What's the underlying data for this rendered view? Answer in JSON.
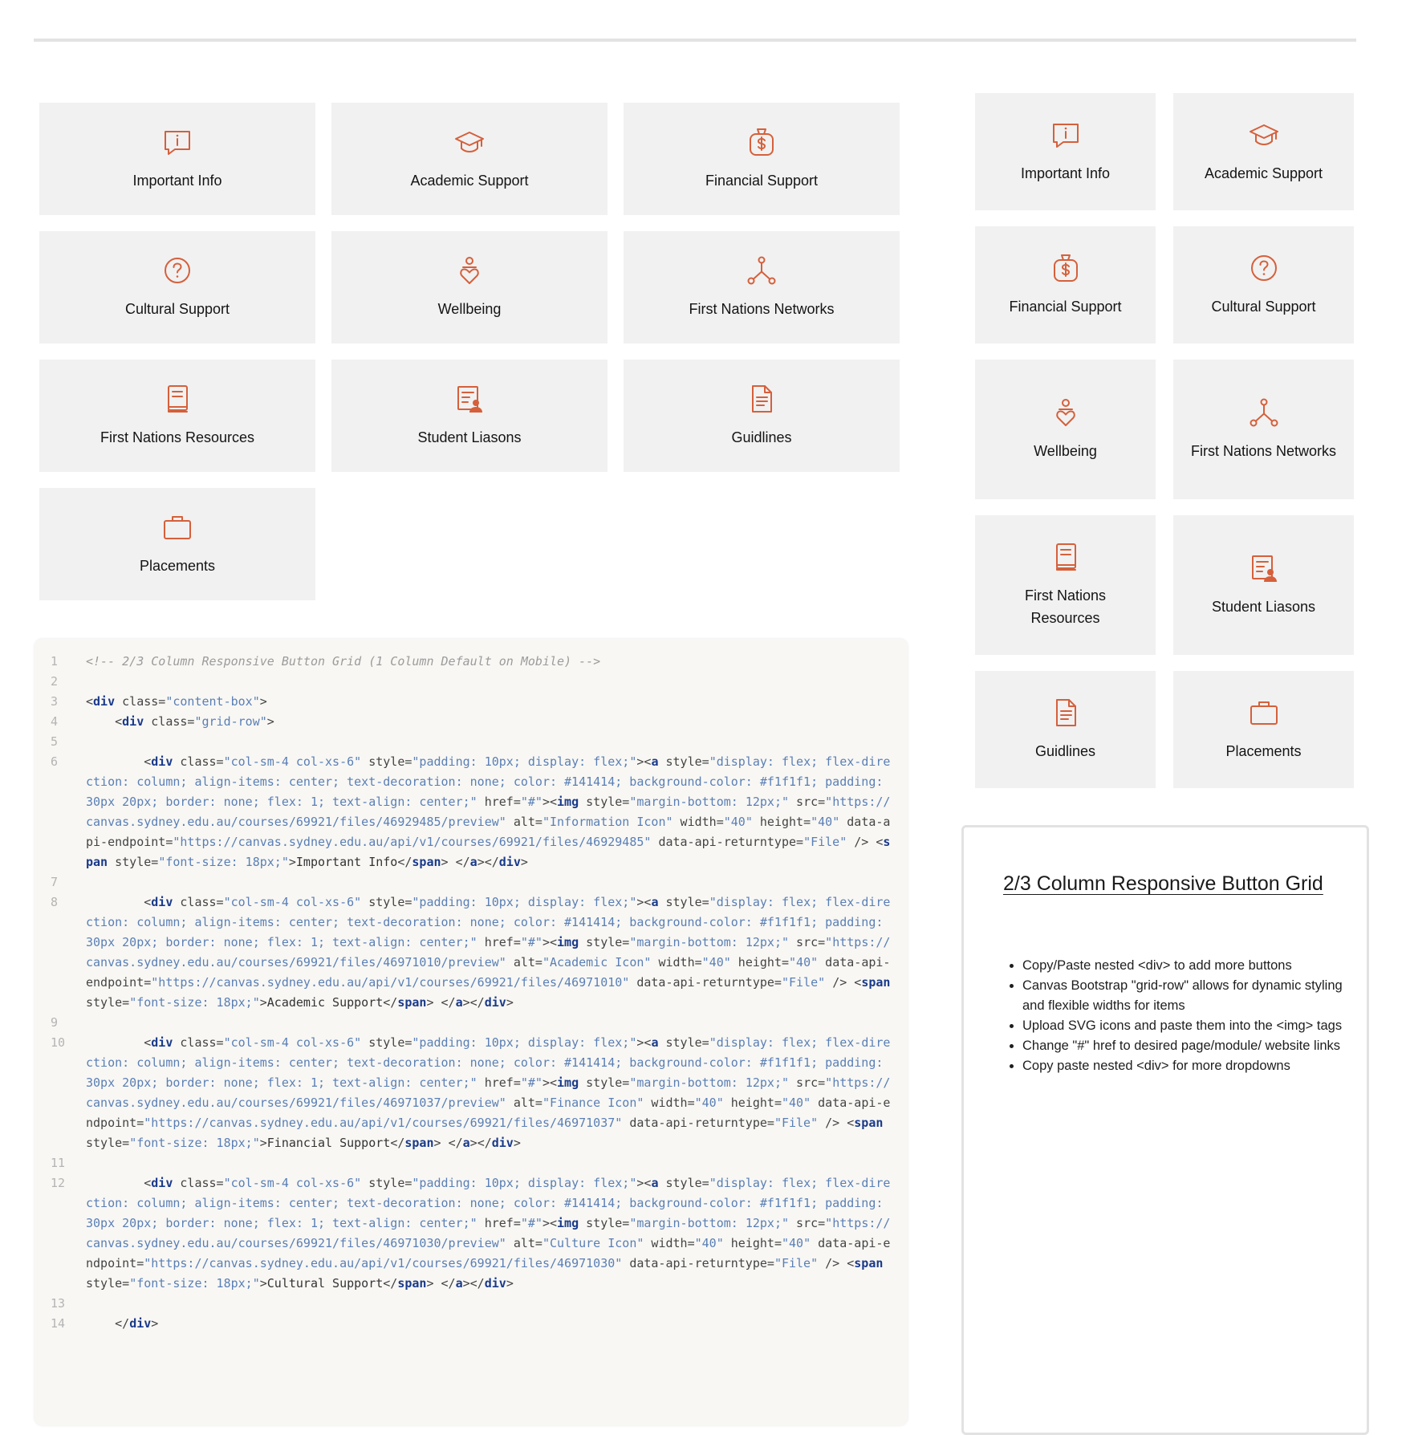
{
  "colors": {
    "accent": "#d5603b",
    "card_bg": "#f1f1f1",
    "text": "#141414"
  },
  "grid_three_col": [
    {
      "label": "Important Info",
      "icon": "info-icon"
    },
    {
      "label": "Academic Support",
      "icon": "graduation-cap-icon"
    },
    {
      "label": "Financial Support",
      "icon": "money-bag-icon"
    },
    {
      "label": "Cultural Support",
      "icon": "question-circle-icon"
    },
    {
      "label": "Wellbeing",
      "icon": "person-heart-icon"
    },
    {
      "label": "First Nations Networks",
      "icon": "network-icon"
    },
    {
      "label": "First Nations Resources",
      "icon": "book-icon"
    },
    {
      "label": "Student Liasons",
      "icon": "student-liaison-icon"
    },
    {
      "label": "Guidlines",
      "icon": "document-icon"
    },
    {
      "label": "Placements",
      "icon": "briefcase-icon"
    }
  ],
  "grid_two_col": [
    {
      "label": "Important Info",
      "icon": "info-icon"
    },
    {
      "label": "Academic Support",
      "icon": "graduation-cap-icon"
    },
    {
      "label": "Financial Support",
      "icon": "money-bag-icon"
    },
    {
      "label": "Cultural Support",
      "icon": "question-circle-icon"
    },
    {
      "label": "Wellbeing",
      "icon": "person-heart-icon"
    },
    {
      "label": "First Nations Networks",
      "icon": "network-icon"
    },
    {
      "label": "First Nations Resources",
      "icon": "book-icon"
    },
    {
      "label": "Student Liasons",
      "icon": "student-liaison-icon"
    },
    {
      "label": "Guidlines",
      "icon": "document-icon"
    },
    {
      "label": "Placements",
      "icon": "briefcase-icon"
    }
  ],
  "code_lines": [
    {
      "n": "1",
      "text": "<!-- 2/3 Column Responsive Button Grid (1 Column Default on Mobile) -->"
    },
    {
      "n": "2",
      "text": ""
    },
    {
      "n": "3",
      "text": "<div class=\"content-box\">"
    },
    {
      "n": "4",
      "text": "    <div class=\"grid-row\">"
    },
    {
      "n": "5",
      "text": ""
    },
    {
      "n": "6",
      "text": "        <div class=\"col-sm-4 col-xs-6\" style=\"padding: 10px; display: flex;\"><a style=\"display: flex; flex-direction: column; align-items: center; text-decoration: none; color: #141414; background-color: #f1f1f1; padding: 30px 20px; border: none; flex: 1; text-align: center;\" href=\"#\"><img style=\"margin-bottom: 12px;\" src=\"https://canvas.sydney.edu.au/courses/69921/files/46929485/preview\" alt=\"Information Icon\" width=\"40\" height=\"40\" data-api-endpoint=\"https://canvas.sydney.edu.au/api/v1/courses/69921/files/46929485\" data-api-returntype=\"File\" /> <span style=\"font-size: 18px;\">Important Info</span> </a></div>"
    },
    {
      "n": "7",
      "text": ""
    },
    {
      "n": "8",
      "text": "        <div class=\"col-sm-4 col-xs-6\" style=\"padding: 10px; display: flex;\"><a style=\"display: flex; flex-direction: column; align-items: center; text-decoration: none; color: #141414; background-color: #f1f1f1; padding: 30px 20px; border: none; flex: 1; text-align: center;\" href=\"#\"><img style=\"margin-bottom: 12px;\" src=\"https://canvas.sydney.edu.au/courses/69921/files/46971010/preview\" alt=\"Academic Icon\" width=\"40\" height=\"40\" data-api-endpoint=\"https://canvas.sydney.edu.au/api/v1/courses/69921/files/46971010\" data-api-returntype=\"File\" /> <span style=\"font-size: 18px;\">Academic Support</span> </a></div>"
    },
    {
      "n": "9",
      "text": ""
    },
    {
      "n": "10",
      "text": "        <div class=\"col-sm-4 col-xs-6\" style=\"padding: 10px; display: flex;\"><a style=\"display: flex; flex-direction: column; align-items: center; text-decoration: none; color: #141414; background-color: #f1f1f1; padding: 30px 20px; border: none; flex: 1; text-align: center;\" href=\"#\"><img style=\"margin-bottom: 12px;\" src=\"https://canvas.sydney.edu.au/courses/69921/files/46971037/preview\" alt=\"Finance Icon\" width=\"40\" height=\"40\" data-api-endpoint=\"https://canvas.sydney.edu.au/api/v1/courses/69921/files/46971037\" data-api-returntype=\"File\" /> <span style=\"font-size: 18px;\">Financial Support</span> </a></div>"
    },
    {
      "n": "11",
      "text": ""
    },
    {
      "n": "12",
      "text": "        <div class=\"col-sm-4 col-xs-6\" style=\"padding: 10px; display: flex;\"><a style=\"display: flex; flex-direction: column; align-items: center; text-decoration: none; color: #141414; background-color: #f1f1f1; padding: 30px 20px; border: none; flex: 1; text-align: center;\" href=\"#\"><img style=\"margin-bottom: 12px;\" src=\"https://canvas.sydney.edu.au/courses/69921/files/46971030/preview\" alt=\"Culture Icon\" width=\"40\" height=\"40\" data-api-endpoint=\"https://canvas.sydney.edu.au/api/v1/courses/69921/files/46971030\" data-api-returntype=\"File\" /> <span style=\"font-size: 18px;\">Cultural Support</span> </a></div>"
    },
    {
      "n": "13",
      "text": ""
    },
    {
      "n": "14",
      "text": "    </div>"
    }
  ],
  "info_panel": {
    "title": "2/3 Column Responsive Button Grid",
    "bullets": [
      "Copy/Paste nested <div> to add more buttons",
      "Canvas Bootstrap \"grid-row\" allows for dynamic styling and flexible widths for items",
      "Upload SVG icons and paste them into the <img> tags",
      "Change \"#\" href to desired page/module/ website links",
      "Copy paste nested <div> for more dropdowns"
    ]
  }
}
